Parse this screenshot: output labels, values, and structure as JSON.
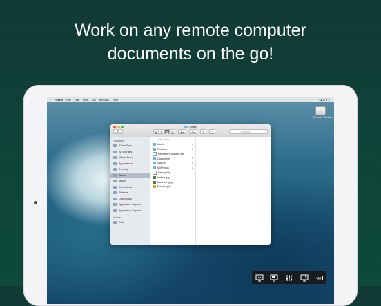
{
  "headline": {
    "line1": "Work on any remote computer",
    "line2": "documents on the go!"
  },
  "menubar": {
    "items": [
      "",
      "Finder",
      "File",
      "Edit",
      "View",
      "Go",
      "Window",
      "Help"
    ],
    "status": "◦ ▴ ☰ ⌕ ≡"
  },
  "desktop_icon": {
    "label": "RemotePCFolder"
  },
  "finder": {
    "title": "Share",
    "toolbar": {
      "back": "‹",
      "forward": "›",
      "view_icon": "▦",
      "view_list": "☰",
      "view_column": "▥",
      "view_cover": "▤",
      "arrange": "▦▾",
      "action": "⚙▾",
      "share": "⇧",
      "tags": "◯",
      "search_placeholder": "Search"
    },
    "sidebar": {
      "favorites_heading": "Favorites",
      "favorites": [
        "iDrive-Sync",
        "All My Files",
        "iCloud Drive",
        "Applications",
        "Desktop",
        "Share",
        "Music",
        "Documents",
        "Pictures",
        "Downloads",
        "Application Support",
        "Application Support"
      ],
      "devices_heading": "Devices",
      "devices": [
        "Data"
      ]
    },
    "column1": [
      {
        "name": ".DS_Store",
        "kind": "none",
        "dim": true,
        "arrow": ""
      },
      {
        "name": "Music",
        "kind": "folder",
        "dim": false,
        "arrow": "▸"
      },
      {
        "name": "Pictures",
        "kind": "folder",
        "dim": false,
        "arrow": "▸"
      },
      {
        "name": "RemotePCService.zip",
        "kind": "doc",
        "dim": false,
        "arrow": ""
      },
      {
        "name": "Documents",
        "kind": "folder",
        "dim": false,
        "arrow": "▸"
      },
      {
        "name": "Videos",
        "kind": "folder",
        "dim": false,
        "arrow": "▸"
      },
      {
        "name": "MyPhotos",
        "kind": "folder",
        "dim": false,
        "arrow": "▸"
      },
      {
        "name": "Family.tiriy",
        "kind": "doc",
        "dim": false,
        "arrow": ""
      },
      {
        "name": "Nature.jpg",
        "kind": "img",
        "dim": false,
        "arrow": ""
      },
      {
        "name": "Mountain.jpg",
        "kind": "img",
        "dim": false,
        "arrow": ""
      },
      {
        "name": "Flowers.jpg",
        "kind": "img2",
        "dim": false,
        "arrow": ""
      }
    ]
  },
  "bottom_toolbar": {
    "tools": [
      "screen-share-icon",
      "display-settings-icon",
      "sliders-icon",
      "switch-monitor-icon",
      "keyboard-icon"
    ]
  },
  "colors": {
    "background": "#0f4238",
    "accent": "#6fb2e6",
    "toolbar_bg": "#191919"
  }
}
